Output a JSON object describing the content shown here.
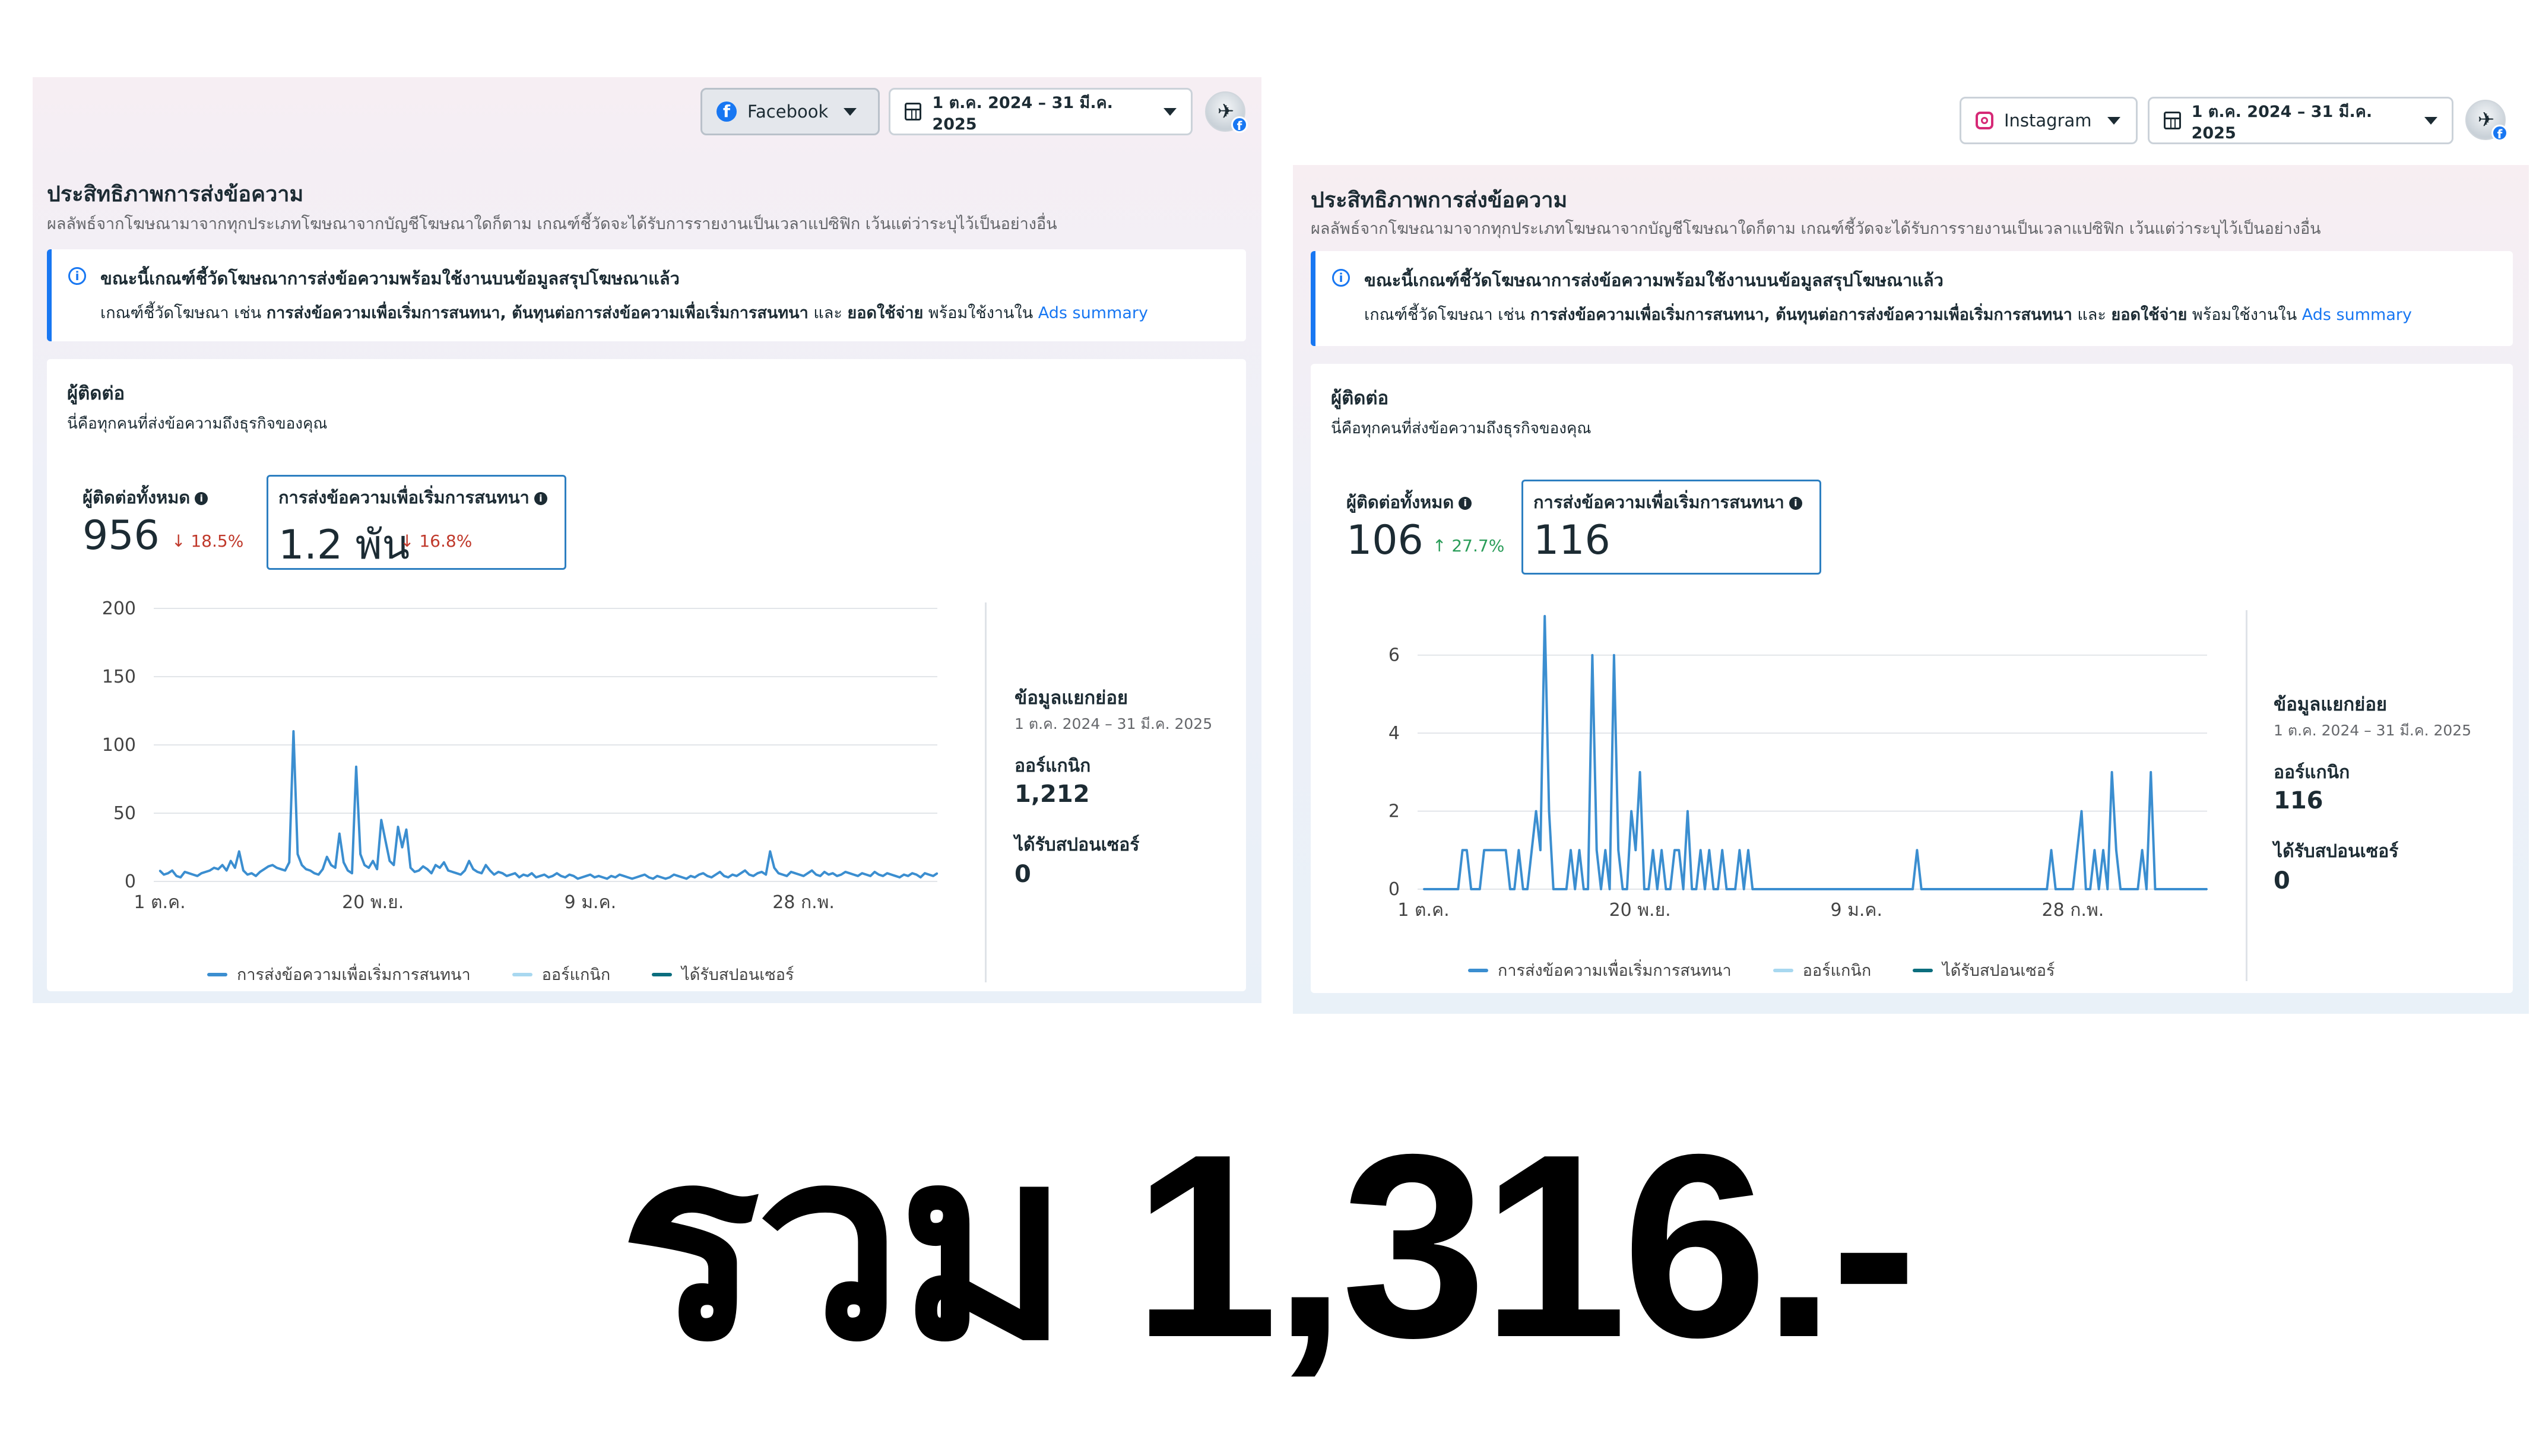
{
  "facebook": {
    "platform_label": "Facebook",
    "date_range_label": "1 ต.ค. 2024 – 31 มี.ค. 2025",
    "title": "ประสิทธิภาพการส่งข้อความ",
    "subtitle": "ผลลัพธ์จากโฆษณามาจากทุกประเภทโฆษณาจากบัญชีโฆษณาใดก็ตาม เกณฑ์ชี้วัดจะได้รับการรายงานเป็นเวลาแปซิฟิก เว้นแต่ว่าระบุไว้เป็นอย่างอื่น",
    "notice": {
      "heading": "ขณะนี้เกณฑ์ชี้วัดโฆษณาการส่งข้อความพร้อมใช้งานบนข้อมูลสรุปโฆษณาแล้ว",
      "body_prefix": "เกณฑ์ชี้วัดโฆษณา เช่น",
      "body_bold1": "การส่งข้อความเพื่อเริ่มการสนทนา, ต้นทุนต่อการส่งข้อความเพื่อเริ่มการสนทนา",
      "body_and": "และ",
      "body_bold2": "ยอดใช้จ่าย",
      "body_suffix": "พร้อมใช้งานใน",
      "link": "Ads summary"
    },
    "card": {
      "title": "ผู้ติดต่อ",
      "subtitle": "นี่คือทุกคนที่ส่งข้อความถึงธุรกิจของคุณ",
      "metric1_label": "ผู้ติดต่อทั้งหมด",
      "metric1_value": "956",
      "metric1_delta": "↓ 18.5%",
      "metric2_label": "การส่งข้อความเพื่อเริ่มการสนทนา",
      "metric2_value": "1.2 พัน",
      "metric2_delta": "↓ 16.8%",
      "side_title": "ข้อมูลแยกย่อย",
      "side_range": "1 ต.ค. 2024 – 31 มี.ค. 2025",
      "organic_label": "ออร์แกนิก",
      "organic_value": "1,212",
      "sponsored_label": "ได้รับสปอนเซอร์",
      "sponsored_value": "0"
    },
    "chart_data": {
      "type": "line",
      "y_ticks": [
        "0",
        "50",
        "100",
        "150",
        "200"
      ],
      "x_ticks": [
        "1 ต.ค.",
        "20 พ.ย.",
        "9 ม.ค.",
        "28 ก.พ."
      ],
      "ylim": [
        0,
        200
      ],
      "series": [
        {
          "name": "การส่งข้อความเพื่อเริ่มการสนทนา",
          "color": "#3b8ed0",
          "values": [
            8,
            5,
            6,
            8,
            4,
            3,
            7,
            6,
            5,
            4,
            6,
            7,
            8,
            10,
            9,
            12,
            8,
            15,
            10,
            22,
            8,
            5,
            6,
            4,
            7,
            9,
            11,
            12,
            10,
            9,
            8,
            14,
            110,
            20,
            12,
            9,
            8,
            6,
            5,
            9,
            18,
            12,
            10,
            35,
            14,
            8,
            6,
            84,
            20,
            12,
            10,
            15,
            9,
            45,
            30,
            15,
            12,
            40,
            25,
            38,
            10,
            7,
            8,
            11,
            9,
            6,
            12,
            10,
            14,
            8,
            7,
            6,
            5,
            8,
            15,
            9,
            7,
            6,
            12,
            8,
            5,
            7,
            6,
            4,
            5,
            6,
            3,
            5,
            4,
            6,
            3,
            4,
            5,
            3,
            4,
            6,
            4,
            3,
            5,
            4,
            2,
            3,
            4,
            5,
            3,
            4,
            3,
            2,
            4,
            3,
            5,
            4,
            3,
            2,
            3,
            4,
            5,
            3,
            2,
            4,
            3,
            2,
            3,
            5,
            4,
            3,
            2,
            4,
            3,
            5,
            6,
            4,
            3,
            5,
            7,
            4,
            3,
            5,
            4,
            6,
            8,
            5,
            4,
            6,
            7,
            5,
            22,
            10,
            6,
            5,
            4,
            7,
            6,
            5,
            4,
            6,
            8,
            5,
            4,
            7,
            5,
            6,
            4,
            5,
            7,
            6,
            5,
            4,
            6,
            5,
            4,
            7,
            5,
            4,
            6,
            5,
            4,
            3,
            5,
            4,
            6,
            5,
            3,
            6,
            5,
            4,
            6
          ]
        },
        {
          "name": "ออร์แกนิก",
          "color": "#a8d8f0",
          "values": []
        },
        {
          "name": "ได้รับสปอนเซอร์",
          "color": "#0c6e7e",
          "values": []
        }
      ]
    }
  },
  "instagram": {
    "platform_label": "Instagram",
    "date_range_label": "1 ต.ค. 2024 – 31 มี.ค. 2025",
    "title": "ประสิทธิภาพการส่งข้อความ",
    "subtitle": "ผลลัพธ์จากโฆษณามาจากทุกประเภทโฆษณาจากบัญชีโฆษณาใดก็ตาม เกณฑ์ชี้วัดจะได้รับการรายงานเป็นเวลาแปซิฟิก เว้นแต่ว่าระบุไว้เป็นอย่างอื่น",
    "notice": {
      "heading": "ขณะนี้เกณฑ์ชี้วัดโฆษณาการส่งข้อความพร้อมใช้งานบนข้อมูลสรุปโฆษณาแล้ว",
      "body_prefix": "เกณฑ์ชี้วัดโฆษณา เช่น",
      "body_bold1": "การส่งข้อความเพื่อเริ่มการสนทนา, ต้นทุนต่อการส่งข้อความเพื่อเริ่มการสนทนา",
      "body_and": "และ",
      "body_bold2": "ยอดใช้จ่าย",
      "body_suffix": "พร้อมใช้งานใน",
      "link": "Ads summary"
    },
    "card": {
      "title": "ผู้ติดต่อ",
      "subtitle": "นี่คือทุกคนที่ส่งข้อความถึงธุรกิจของคุณ",
      "metric1_label": "ผู้ติดต่อทั้งหมด",
      "metric1_value": "106",
      "metric1_delta": "↑ 27.7%",
      "metric2_label": "การส่งข้อความเพื่อเริ่มการสนทนา",
      "metric2_value": "116",
      "side_title": "ข้อมูลแยกย่อย",
      "side_range": "1 ต.ค. 2024 – 31 มี.ค. 2025",
      "organic_label": "ออร์แกนิก",
      "organic_value": "116",
      "sponsored_label": "ได้รับสปอนเซอร์",
      "sponsored_value": "0"
    },
    "chart_data": {
      "type": "line",
      "y_ticks": [
        "0",
        "2",
        "4",
        "6"
      ],
      "x_ticks": [
        "1 ต.ค.",
        "20 พ.ย.",
        "9 ม.ค.",
        "28 ก.พ."
      ],
      "ylim": [
        0,
        7
      ],
      "series": [
        {
          "name": "การส่งข้อความเพื่อเริ่มการสนทนา",
          "color": "#3b8ed0",
          "values": [
            0,
            0,
            0,
            0,
            0,
            0,
            0,
            0,
            0,
            1,
            1,
            0,
            0,
            0,
            1,
            1,
            1,
            1,
            1,
            1,
            0,
            0,
            1,
            0,
            0,
            1,
            2,
            1,
            7,
            2,
            0,
            0,
            0,
            0,
            1,
            0,
            1,
            0,
            0,
            6,
            1,
            0,
            1,
            0,
            6,
            1,
            0,
            0,
            2,
            1,
            3,
            0,
            0,
            1,
            0,
            1,
            0,
            0,
            1,
            1,
            0,
            2,
            0,
            0,
            1,
            0,
            1,
            0,
            0,
            1,
            0,
            0,
            0,
            1,
            0,
            1,
            0,
            0,
            0,
            0,
            0,
            0,
            0,
            0,
            0,
            0,
            0,
            0,
            0,
            0,
            0,
            0,
            0,
            0,
            0,
            0,
            0,
            0,
            0,
            0,
            0,
            0,
            0,
            0,
            0,
            0,
            0,
            0,
            0,
            0,
            0,
            0,
            0,
            0,
            1,
            0,
            0,
            0,
            0,
            0,
            0,
            0,
            0,
            0,
            0,
            0,
            0,
            0,
            0,
            0,
            0,
            0,
            0,
            0,
            0,
            0,
            0,
            0,
            0,
            0,
            0,
            0,
            0,
            0,
            0,
            1,
            0,
            0,
            0,
            0,
            0,
            1,
            2,
            0,
            0,
            1,
            0,
            1,
            0,
            3,
            1,
            0,
            0,
            0,
            0,
            0,
            1,
            0,
            3,
            0,
            0,
            0,
            0,
            0,
            0,
            0,
            0,
            0,
            0,
            0,
            0,
            0
          ]
        },
        {
          "name": "ออร์แกนิก",
          "color": "#a8d8f0",
          "values": []
        },
        {
          "name": "ได้รับสปอนเซอร์",
          "color": "#0c6e7e",
          "values": []
        }
      ]
    }
  },
  "total_caption": "รวม 1,316.-"
}
